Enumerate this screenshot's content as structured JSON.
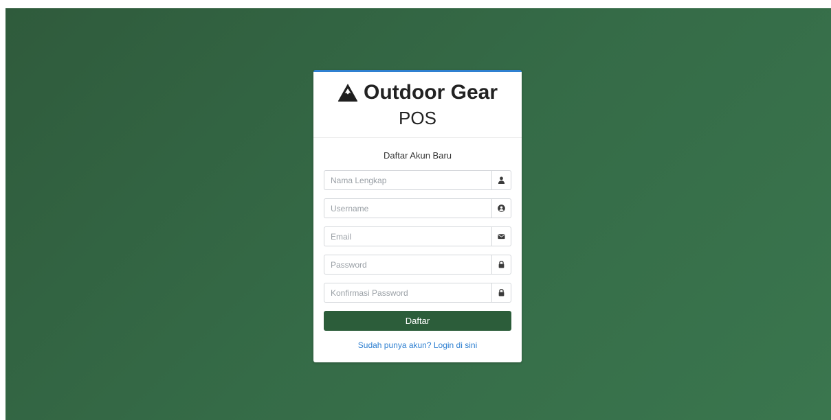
{
  "brand": {
    "title_line1": "Outdoor Gear",
    "title_line2": "POS",
    "icon": "mountain-icon"
  },
  "form": {
    "subtitle": "Daftar Akun Baru",
    "fields": [
      {
        "placeholder": "Nama Lengkap",
        "value": "",
        "icon": "user-icon"
      },
      {
        "placeholder": "Username",
        "value": "",
        "icon": "user-circle-icon"
      },
      {
        "placeholder": "Email",
        "value": "",
        "icon": "envelope-icon"
      },
      {
        "placeholder": "Password",
        "value": "",
        "icon": "lock-icon"
      },
      {
        "placeholder": "Konfirmasi Password",
        "value": "",
        "icon": "lock-icon"
      }
    ],
    "submit_label": "Daftar",
    "login_link": "Sudah punya akun? Login di sini"
  },
  "colors": {
    "background": "#356b47",
    "primary_button": "#2c5d3a",
    "card_accent": "#2f80d1",
    "link": "#2f80d1"
  }
}
